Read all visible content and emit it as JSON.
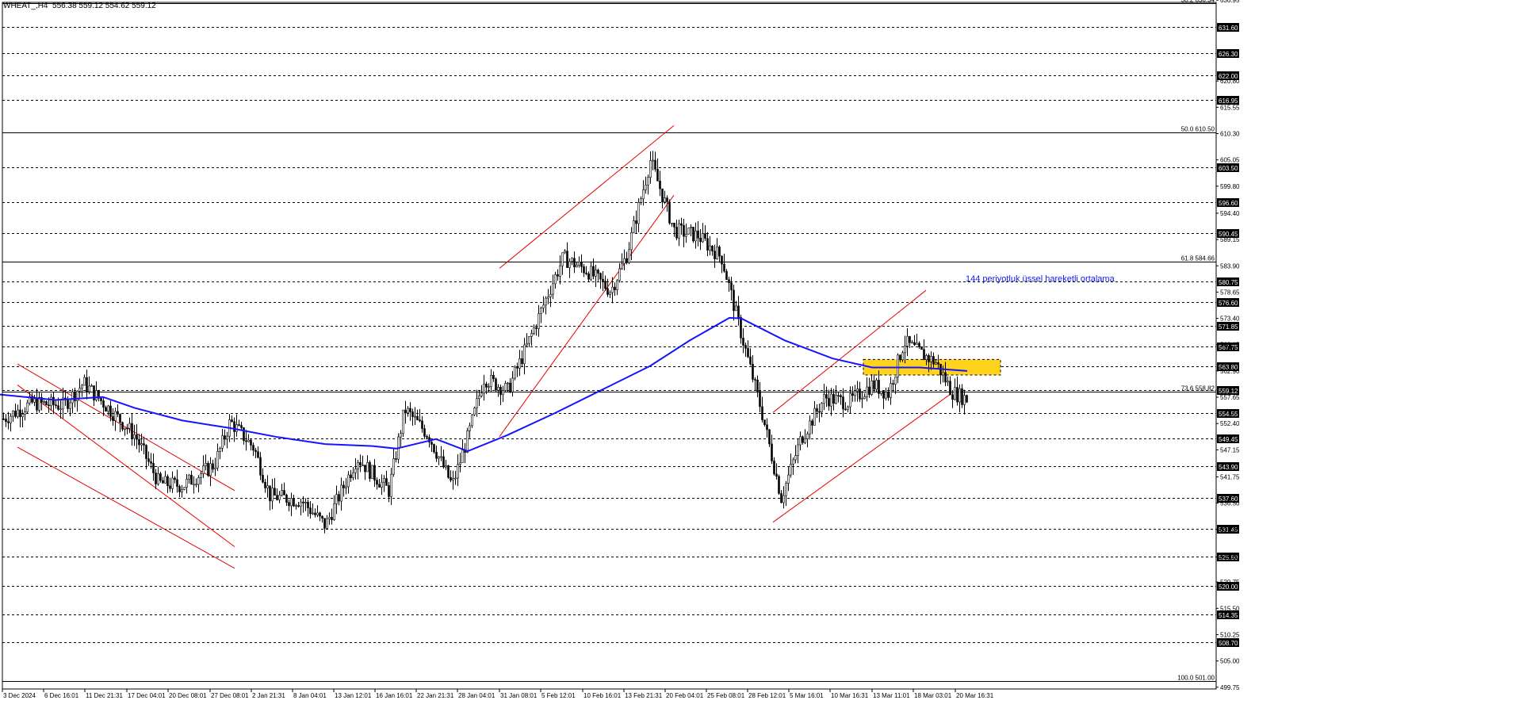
{
  "header": {
    "symbol_line": "WHEAT_,H4  556.38 559.12 554.62 559.12"
  },
  "colors": {
    "grid_dashed": "#000000",
    "ema": "#1414ff",
    "channel": "#e60000",
    "candle": "#000000",
    "highlight_box": "#ffd21e",
    "annotation_text": "#1414ff",
    "level_label_bg": "#000000",
    "level_label_text": "#ffffff"
  },
  "chart_data": {
    "type": "candlestick",
    "title": "",
    "ylim": [
      499.4,
      636.5
    ],
    "grid": true,
    "x_tick_labels": [
      "3 Dec 2024",
      "6 Dec 16:01",
      "11 Dec 21:31",
      "17 Dec 04:01",
      "20 Dec 08:01",
      "27 Dec 08:01",
      "2 Jan 21:31",
      "8 Jan 04:01",
      "13 Jan 12:01",
      "16 Jan 16:01",
      "22 Jan 21:31",
      "28 Jan 04:01",
      "31 Jan 08:01",
      "5 Feb 12:01",
      "10 Feb 16:01",
      "13 Feb 21:31",
      "20 Feb 04:01",
      "25 Feb 08:01",
      "28 Feb 12:01",
      "5 Mar 16:01",
      "10 Mar 16:31",
      "13 Mar 11:01",
      "18 Mar 03:01",
      "20 Mar 16:31"
    ],
    "y_tick_labels": [
      "636.95",
      "620.80",
      "615.55",
      "610.30",
      "605.05",
      "599.80",
      "594.40",
      "589.15",
      "583.90",
      "578.65",
      "573.40",
      "568.15",
      "562.90",
      "557.65",
      "552.40",
      "547.15",
      "541.75",
      "536.50",
      "531.25",
      "525.80",
      "520.75",
      "515.50",
      "510.25",
      "505.00",
      "499.75"
    ],
    "horizontal_levels": [
      "631.60",
      "626.30",
      "622.00",
      "616.95",
      "603.50",
      "596.60",
      "590.45",
      "580.75",
      "576.60",
      "571.85",
      "567.75",
      "563.80",
      "559.12",
      "554.55",
      "549.45",
      "543.90",
      "537.60",
      "531.45",
      "525.80",
      "520.00",
      "514.35",
      "508.70"
    ],
    "fibonacci": [
      {
        "label": "38.2 636.34",
        "value": 636.34
      },
      {
        "label": "50.0 610.50",
        "value": 610.5
      },
      {
        "label": "61.8 584.66",
        "value": 584.66
      },
      {
        "label": "73.6 558.82",
        "value": 558.82
      },
      {
        "label": "100.0 501.00",
        "value": 501.0
      }
    ],
    "annotation": "144 periyotluk üssel hareketli ortalama",
    "ema_points": [
      [
        0,
        558.2
      ],
      [
        70,
        557.1
      ],
      [
        130,
        557.7
      ],
      [
        170,
        555.5
      ],
      [
        230,
        553.0
      ],
      [
        290,
        551.5
      ],
      [
        350,
        549.7
      ],
      [
        410,
        548.3
      ],
      [
        470,
        547.9
      ],
      [
        500,
        547.4
      ],
      [
        550,
        549.3
      ],
      [
        590,
        546.9
      ],
      [
        640,
        550.1
      ],
      [
        700,
        554.5
      ],
      [
        760,
        559.2
      ],
      [
        820,
        563.9
      ],
      [
        870,
        569.0
      ],
      [
        920,
        573.5
      ],
      [
        935,
        573.4
      ],
      [
        990,
        569.0
      ],
      [
        1050,
        565.4
      ],
      [
        1100,
        563.6
      ],
      [
        1160,
        563.6
      ],
      [
        1220,
        562.9
      ]
    ],
    "candles_approx": [
      [
        0,
        553.0
      ],
      [
        40,
        556.5
      ],
      [
        80,
        556.0
      ],
      [
        105,
        560.5
      ],
      [
        130,
        556.5
      ],
      [
        170,
        550.0
      ],
      [
        200,
        540.5
      ],
      [
        230,
        540.0
      ],
      [
        270,
        544.2
      ],
      [
        290,
        552.8
      ],
      [
        320,
        547.5
      ],
      [
        340,
        538.0
      ],
      [
        380,
        537.0
      ],
      [
        410,
        532.0
      ],
      [
        450,
        545.6
      ],
      [
        490,
        539.0
      ],
      [
        510,
        555.3
      ],
      [
        540,
        550.1
      ],
      [
        570,
        540.0
      ],
      [
        590,
        549.9
      ],
      [
        610,
        561.5
      ],
      [
        640,
        559.0
      ],
      [
        665,
        568.2
      ],
      [
        690,
        578.0
      ],
      [
        710,
        585.5
      ],
      [
        740,
        583.0
      ],
      [
        770,
        578.9
      ],
      [
        790,
        586.0
      ],
      [
        820,
        605.0
      ],
      [
        850,
        591.0
      ],
      [
        880,
        589.9
      ],
      [
        910,
        585.5
      ],
      [
        935,
        570.0
      ],
      [
        960,
        555.0
      ],
      [
        985,
        537.6
      ],
      [
        1010,
        549.4
      ],
      [
        1040,
        557.6
      ],
      [
        1070,
        556.6
      ],
      [
        1100,
        560.2
      ],
      [
        1120,
        558.4
      ],
      [
        1140,
        568.7
      ],
      [
        1160,
        566.5
      ],
      [
        1180,
        564.6
      ],
      [
        1200,
        558.8
      ],
      [
        1220,
        557.2
      ]
    ],
    "channels": [
      {
        "name": "dec-down-channel",
        "lines": [
          [
            [
              22,
              564.3
            ],
            [
              296,
              539.0
            ]
          ],
          [
            [
              22,
              560.1
            ],
            [
              296,
              527.8
            ]
          ],
          [
            [
              22,
              547.7
            ],
            [
              296,
              523.5
            ]
          ]
        ]
      },
      {
        "name": "feb-up-channel",
        "lines": [
          [
            [
              630,
              583.4
            ],
            [
              850,
              611.9
            ]
          ],
          [
            [
              630,
              549.8
            ],
            [
              850,
              598.0
            ]
          ]
        ]
      },
      {
        "name": "mar-up-channel",
        "lines": [
          [
            [
              975,
              554.6
            ],
            [
              1168,
              579.0
            ]
          ],
          [
            [
              975,
              532.7
            ],
            [
              1200,
              558.4
            ]
          ]
        ]
      }
    ],
    "highlight_zone": {
      "x_from_candle": 1089,
      "x_to_candle": 1262,
      "y_low": 562.1,
      "y_high": 565.2
    }
  }
}
